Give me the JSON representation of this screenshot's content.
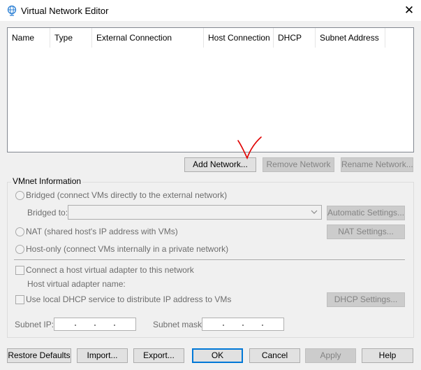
{
  "window": {
    "title": "Virtual Network Editor",
    "close_glyph": "✕"
  },
  "list": {
    "columns": [
      "Name",
      "Type",
      "External Connection",
      "Host Connection",
      "DHCP",
      "Subnet Address"
    ]
  },
  "list_buttons": {
    "add": "Add Network...",
    "remove": "Remove Network",
    "rename": "Rename Network..."
  },
  "vmnet": {
    "group_label": "VMnet Information",
    "bridged_label": "Bridged (connect VMs directly to the external network)",
    "bridged_to_label": "Bridged to:",
    "bridged_to_value": "",
    "auto_settings": "Automatic Settings...",
    "nat_label": "NAT (shared host's IP address with VMs)",
    "nat_settings": "NAT Settings...",
    "hostonly_label": "Host-only (connect VMs internally in a private network)",
    "connect_adapter_label": "Connect a host virtual adapter to this network",
    "adapter_name_label": "Host virtual adapter name:",
    "dhcp_label": "Use local DHCP service to distribute IP address to VMs",
    "dhcp_settings": "DHCP Settings...",
    "subnet_ip_label": "Subnet IP:",
    "subnet_mask_label": "Subnet mask:"
  },
  "footer": {
    "restore": "Restore Defaults",
    "import": "Import...",
    "export": "Export...",
    "ok": "OK",
    "cancel": "Cancel",
    "apply": "Apply",
    "help": "Help"
  },
  "annotation": {
    "color": "#e00000"
  },
  "colors": {
    "focus_border": "#0078d7",
    "window_bg": "#f0f0f0"
  }
}
